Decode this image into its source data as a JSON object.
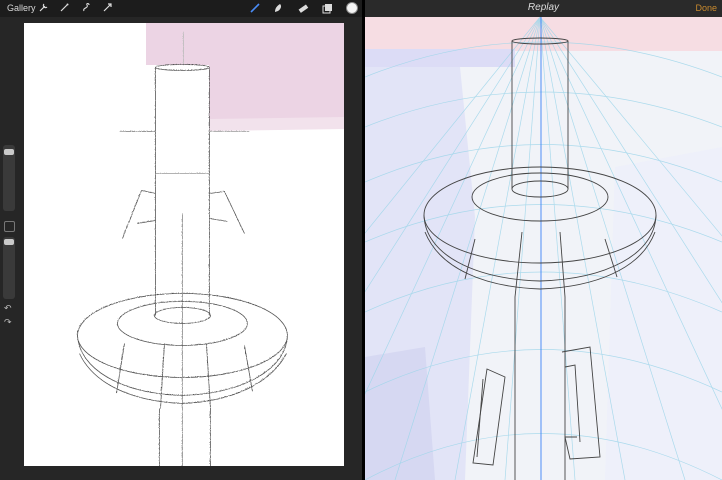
{
  "left_toolbar": {
    "gallery_label": "Gallery",
    "tools": [
      "wrench-icon",
      "magic-wand-icon",
      "selection-icon",
      "transform-icon",
      "brush-icon",
      "smudge-icon",
      "eraser-icon",
      "layers-icon"
    ],
    "active_color": "#f4f4f4"
  },
  "replay": {
    "title": "Replay",
    "done_label": "Done"
  },
  "colors": {
    "pink": "#ecd4e4",
    "blue_tint": "#e2e4f7",
    "grid": "#9fd6ea",
    "accent": "#3b82f6"
  }
}
